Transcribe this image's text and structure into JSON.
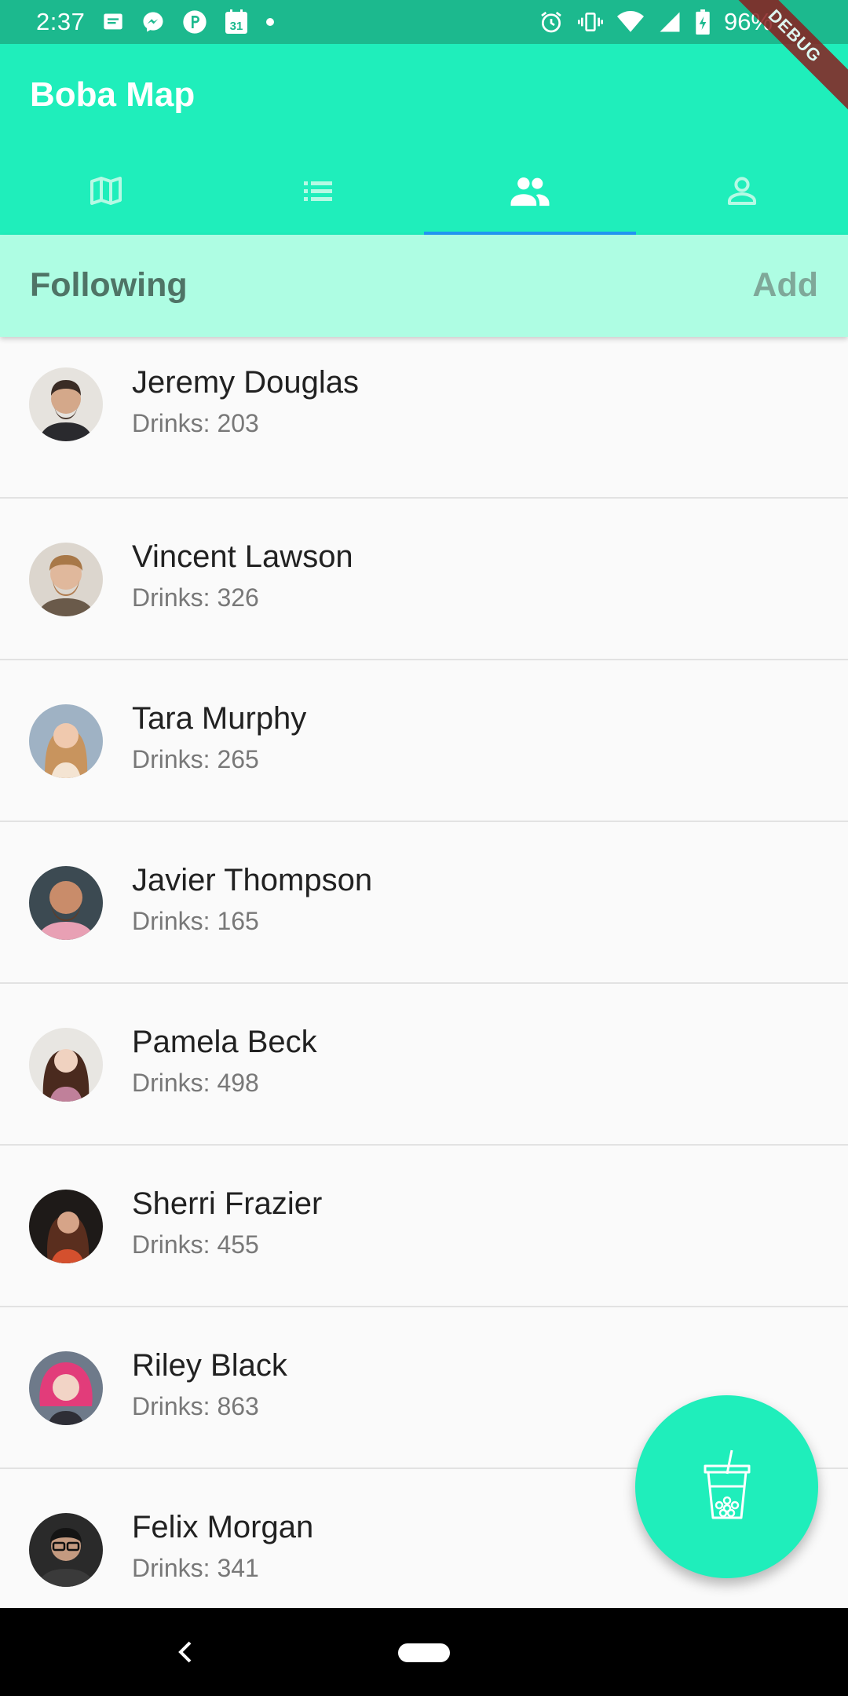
{
  "status_bar": {
    "time": "2:37",
    "battery": "96%",
    "calendar_day": "31",
    "left_icons": [
      "message-icon",
      "messenger-icon",
      "parking-icon",
      "calendar-icon",
      "dot-icon"
    ],
    "right_icons": [
      "alarm-icon",
      "vibrate-icon",
      "wifi-icon",
      "signal-icon",
      "battery-icon"
    ]
  },
  "debug_banner": "DEBUG",
  "app_bar": {
    "title": "Boba Map",
    "tabs": [
      {
        "icon": "map-icon",
        "selected": false
      },
      {
        "icon": "list-icon",
        "selected": false
      },
      {
        "icon": "people-icon",
        "selected": true
      },
      {
        "icon": "person-icon",
        "selected": false
      }
    ]
  },
  "following": {
    "title": "Following",
    "add_label": "Add",
    "users": [
      {
        "name": "Jeremy Douglas",
        "drinks": "Drinks: 203"
      },
      {
        "name": "Vincent Lawson",
        "drinks": "Drinks: 326"
      },
      {
        "name": "Tara Murphy",
        "drinks": "Drinks: 265"
      },
      {
        "name": "Javier Thompson",
        "drinks": "Drinks: 165"
      },
      {
        "name": "Pamela Beck",
        "drinks": "Drinks: 498"
      },
      {
        "name": "Sherri Frazier",
        "drinks": "Drinks: 455"
      },
      {
        "name": "Riley Black",
        "drinks": "Drinks: 863"
      },
      {
        "name": "Felix Morgan",
        "drinks": "Drinks: 341"
      }
    ]
  },
  "fab": {
    "icon": "boba-cup-icon"
  },
  "colors": {
    "app_bar": "#1feebb",
    "status_bar": "#1cb98e",
    "header_band": "#aefde3",
    "tab_indicator": "#2196f3"
  }
}
